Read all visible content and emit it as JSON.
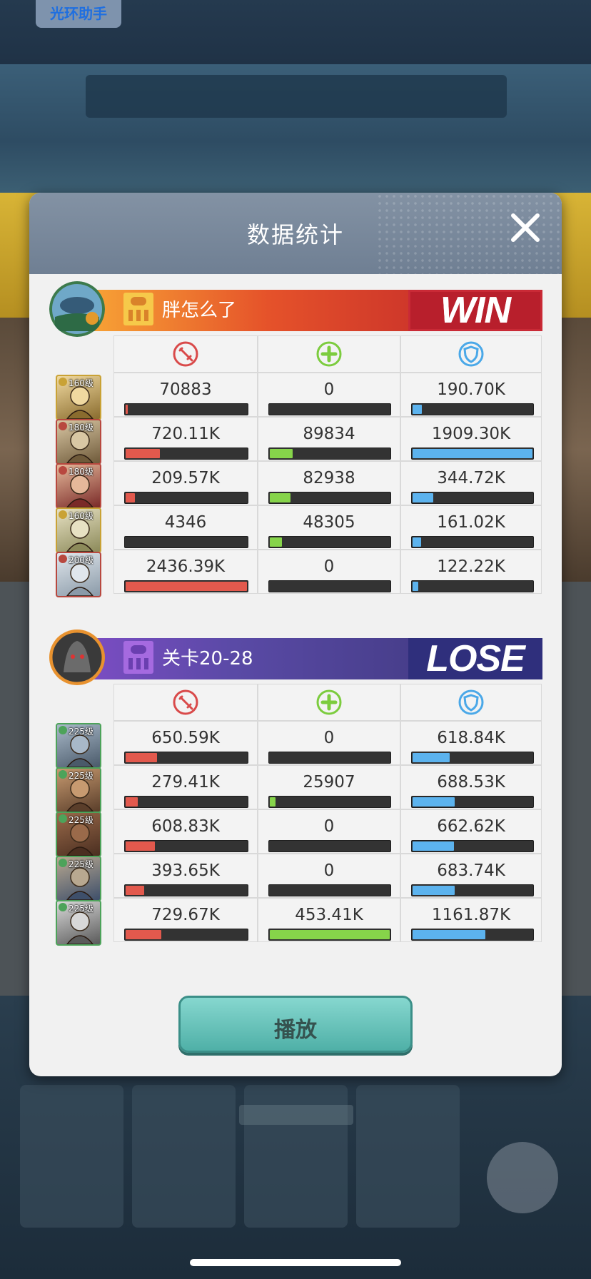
{
  "assist_badge": "光环助手",
  "dialog": {
    "title": "数据统计",
    "play_label": "播放",
    "colors": {
      "damage": "#e2594d",
      "heal": "#86d44a",
      "tank": "#5cb3ee"
    },
    "stat_icons": [
      "sword-icon",
      "heal-cross-icon",
      "shield-icon"
    ]
  },
  "teams": [
    {
      "name": "胖怎么了",
      "result": "WIN",
      "heroes": [
        {
          "level": "160级",
          "damage": "70883",
          "damage_pct": 3,
          "heal": "0",
          "heal_pct": 0,
          "tank": "190.70K",
          "tank_pct": 9
        },
        {
          "level": "180级",
          "damage": "720.11K",
          "damage_pct": 29,
          "heal": "89834",
          "heal_pct": 20,
          "tank": "1909.30K",
          "tank_pct": 100
        },
        {
          "level": "180级",
          "damage": "209.57K",
          "damage_pct": 9,
          "heal": "82938",
          "heal_pct": 18,
          "tank": "344.72K",
          "tank_pct": 18
        },
        {
          "level": "160级",
          "damage": "4346",
          "damage_pct": 0,
          "heal": "48305",
          "heal_pct": 11,
          "tank": "161.02K",
          "tank_pct": 8
        },
        {
          "level": "200级",
          "damage": "2436.39K",
          "damage_pct": 100,
          "heal": "0",
          "heal_pct": 0,
          "tank": "122.22K",
          "tank_pct": 6
        }
      ]
    },
    {
      "name": "关卡20-28",
      "result": "LOSE",
      "heroes": [
        {
          "level": "225级",
          "damage": "650.59K",
          "damage_pct": 27,
          "heal": "0",
          "heal_pct": 0,
          "tank": "618.84K",
          "tank_pct": 32
        },
        {
          "level": "225级",
          "damage": "279.41K",
          "damage_pct": 11,
          "heal": "25907",
          "heal_pct": 6,
          "tank": "688.53K",
          "tank_pct": 36
        },
        {
          "level": "225级",
          "damage": "608.83K",
          "damage_pct": 25,
          "heal": "0",
          "heal_pct": 0,
          "tank": "662.62K",
          "tank_pct": 35
        },
        {
          "level": "225级",
          "damage": "393.65K",
          "damage_pct": 16,
          "heal": "0",
          "heal_pct": 0,
          "tank": "683.74K",
          "tank_pct": 36
        },
        {
          "level": "225级",
          "damage": "729.67K",
          "damage_pct": 30,
          "heal": "453.41K",
          "heal_pct": 100,
          "tank": "1161.87K",
          "tank_pct": 61
        }
      ]
    }
  ]
}
